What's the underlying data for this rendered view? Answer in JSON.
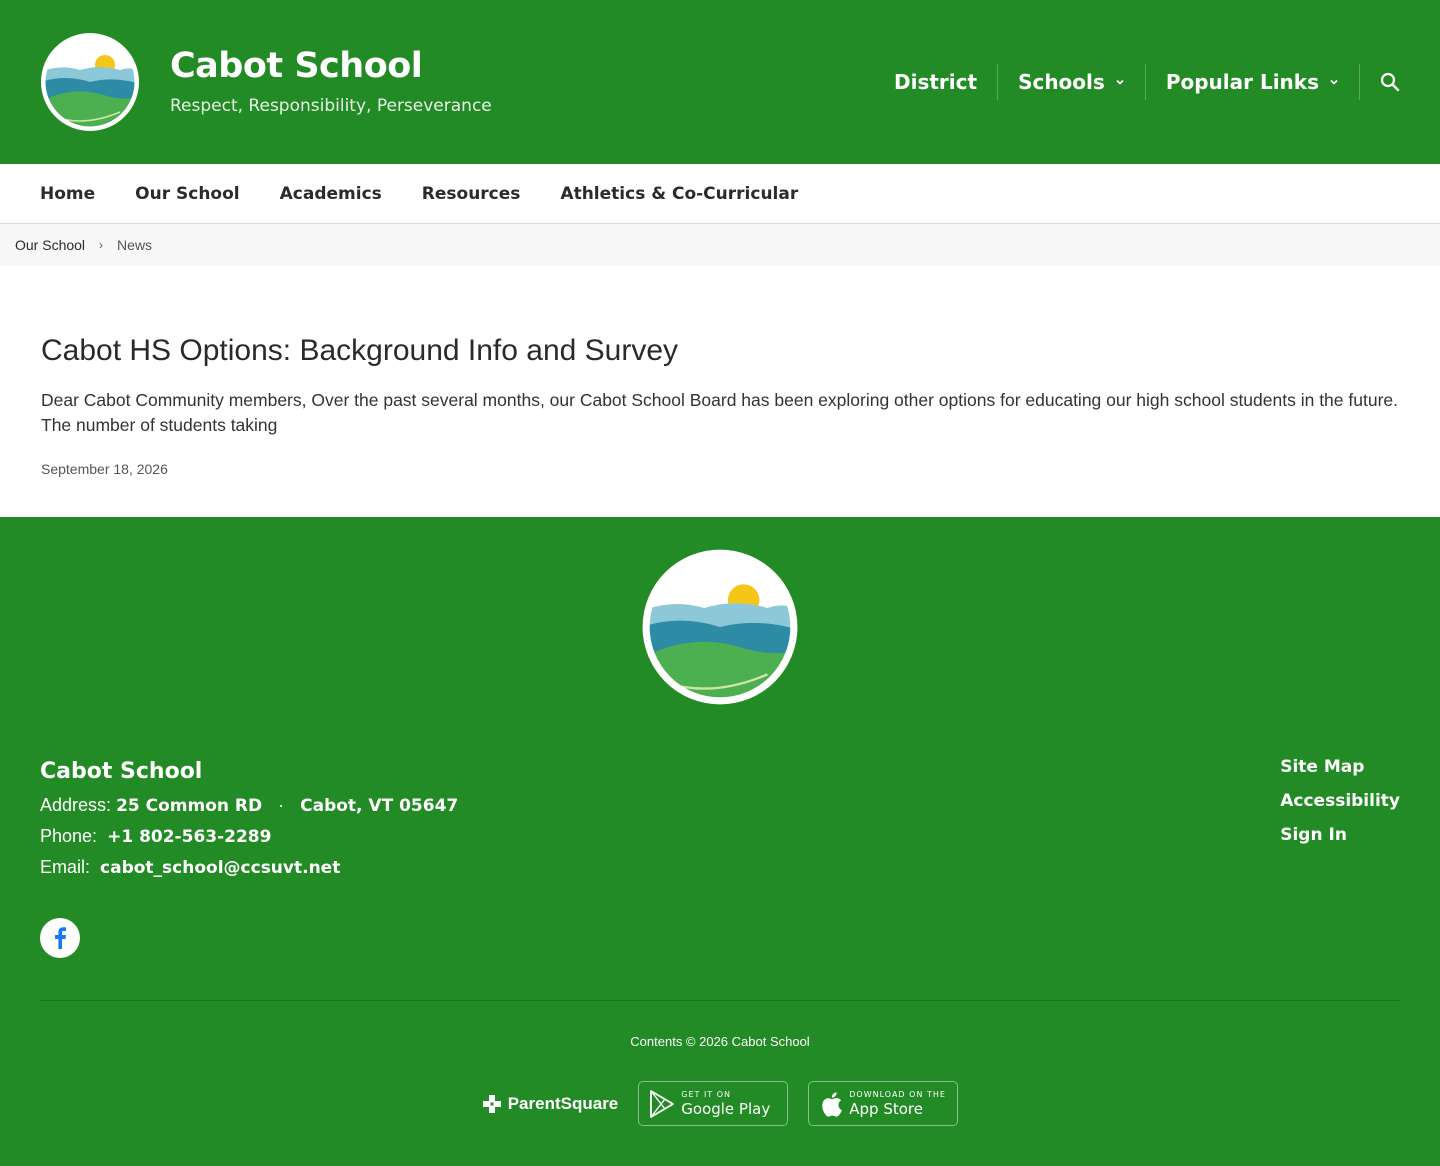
{
  "header": {
    "school_name": "Cabot School",
    "motto": "Respect, Responsibility, Perseverance",
    "top_nav": [
      {
        "label": "District",
        "has_dropdown": false
      },
      {
        "label": "Schools",
        "has_dropdown": true
      },
      {
        "label": "Popular Links",
        "has_dropdown": true
      }
    ]
  },
  "main_nav": [
    "Home",
    "Our School",
    "Academics",
    "Resources",
    "Athletics & Co-Curricular"
  ],
  "breadcrumb": {
    "parent": "Our School",
    "current": "News"
  },
  "article": {
    "title": "Cabot HS Options: Background Info and Survey",
    "summary": "Dear Cabot Community members, Over the past several months, our Cabot School Board has been exploring other options for educating our high school students in the future. The number of students taking",
    "date": "September 18, 2026"
  },
  "footer": {
    "school_name": "Cabot School",
    "address_label": "Address:",
    "address_street": "25 Common RD",
    "address_separator": "·",
    "address_city": "Cabot, VT 05647",
    "phone_label": "Phone:",
    "phone": "+1 802-563-2289",
    "email_label": "Email:",
    "email": "cabot_school@ccsuvt.net",
    "links": [
      "Site Map",
      "Accessibility",
      "Sign In"
    ],
    "copyright": "Contents © 2026 Cabot School",
    "parentsquare_label": "ParentSquare",
    "google_play": {
      "small": "GET IT ON",
      "big": "Google Play"
    },
    "app_store": {
      "small": "DOWNLOAD ON THE",
      "big": "App Store"
    }
  },
  "colors": {
    "brand_green": "#238b25",
    "sun": "#f5c518",
    "sky": "#8dc8d8",
    "water": "#2e8ba6",
    "hills": "#4caf50"
  },
  "icons": [
    "search-icon",
    "chevron-down-icon",
    "facebook-icon",
    "parentsquare-icon",
    "google-play-icon",
    "apple-icon"
  ]
}
